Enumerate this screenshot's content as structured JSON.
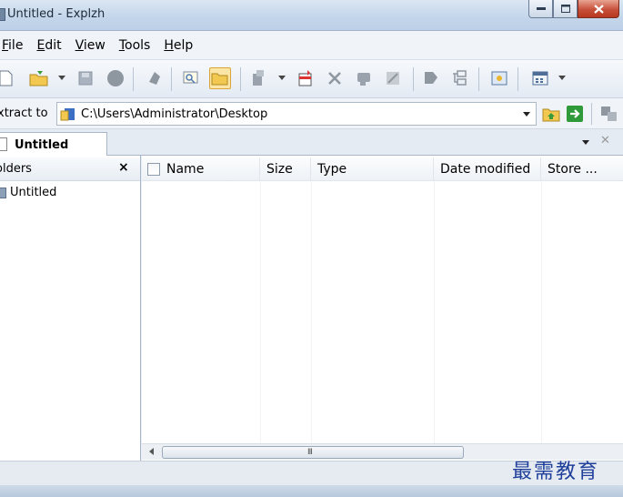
{
  "window": {
    "title": "Untitled - Explzh"
  },
  "menu": [
    {
      "key": "F",
      "rest": "ile"
    },
    {
      "key": "E",
      "rest": "dit"
    },
    {
      "key": "V",
      "rest": "iew"
    },
    {
      "key": "T",
      "rest": "ools"
    },
    {
      "key": "H",
      "rest": "elp"
    }
  ],
  "extract": {
    "label": "xtract to",
    "path": "C:\\Users\\Administrator\\Desktop"
  },
  "tab": {
    "label": "Untitled"
  },
  "folders": {
    "title": "olders",
    "close": "×",
    "items": [
      {
        "label": "Untitled"
      }
    ]
  },
  "list": {
    "columns": {
      "name": "Name",
      "size": "Size",
      "type": "Type",
      "date": "Date modified",
      "store": "Store ..."
    },
    "scroll_grip": "III"
  },
  "watermark": "最需教育",
  "colors": {
    "accent": "#fde5a6",
    "close_button": "#c7503a",
    "watermark": "#1f3f9a"
  }
}
